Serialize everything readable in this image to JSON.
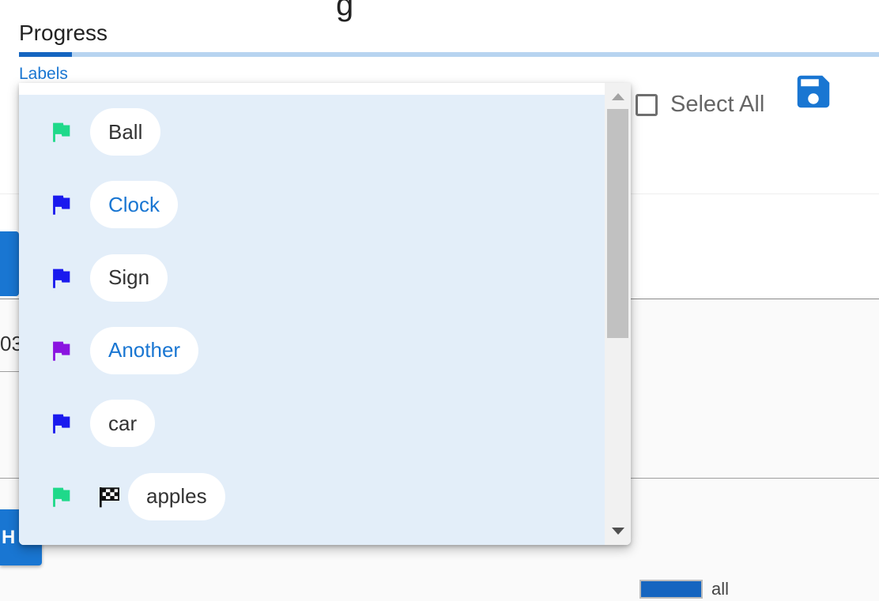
{
  "progress": {
    "label": "Progress",
    "value_fraction": 0.062
  },
  "labels_link": "Labels",
  "select_all": {
    "label": "Select All",
    "checked": false
  },
  "background": {
    "partial_text": "03",
    "button_letter": "H",
    "legend_label": "all"
  },
  "dropdown": {
    "items": [
      {
        "label": "Ball",
        "flag_color": "#1fd98a",
        "style": "plain",
        "icon": "flag-icon"
      },
      {
        "label": "Clock",
        "flag_color": "#1a1aee",
        "style": "link",
        "icon": "flag-icon"
      },
      {
        "label": "Sign",
        "flag_color": "#1a1aee",
        "style": "plain",
        "icon": "flag-icon"
      },
      {
        "label": "Another",
        "flag_color": "#8a14e0",
        "style": "link",
        "icon": "flag-icon"
      },
      {
        "label": "car",
        "flag_color": "#1a1aee",
        "style": "plain",
        "icon": "flag-icon"
      },
      {
        "label": "apples",
        "flag_color": "#1fd98a",
        "style": "plain",
        "icon": "flag-icon",
        "extra_icon": "checkered-flag-icon"
      }
    ]
  },
  "colors": {
    "accent": "#1976d2",
    "dropdown_bg": "#e3eef9",
    "progress_track": "#b7d4f0",
    "progress_fill": "#1565c0"
  }
}
